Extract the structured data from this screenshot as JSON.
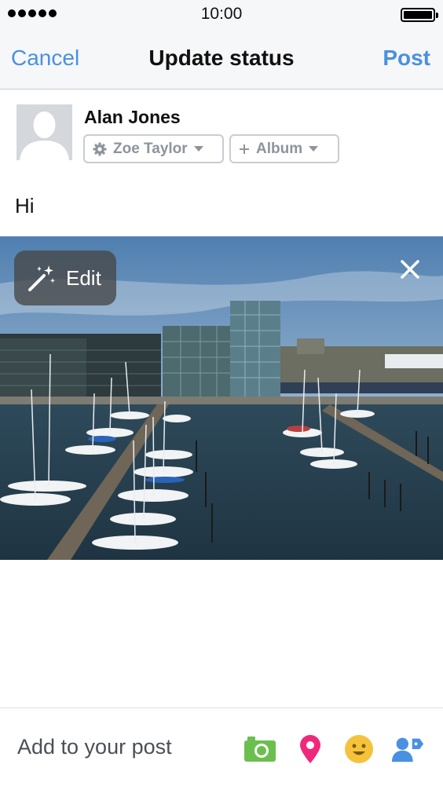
{
  "status_bar": {
    "time": "10:00",
    "signal_dots": 5,
    "battery_level": 1.0
  },
  "nav": {
    "cancel_label": "Cancel",
    "title": "Update status",
    "post_label": "Post"
  },
  "composer": {
    "author_name": "Alan Jones",
    "audience_label": "Zoe Taylor",
    "album_label": "Album",
    "status_text": "Hi"
  },
  "photo": {
    "edit_label": "Edit"
  },
  "bottom_bar": {
    "add_label": "Add to your post",
    "tools": [
      "camera-icon",
      "location-pin-icon",
      "feeling-smiley-icon",
      "tag-people-icon"
    ]
  },
  "colors": {
    "accent": "#4a90e2",
    "camera": "#6bbf4e",
    "location": "#f0287b",
    "feeling": "#f5c33b",
    "tag": "#4a90e2"
  }
}
